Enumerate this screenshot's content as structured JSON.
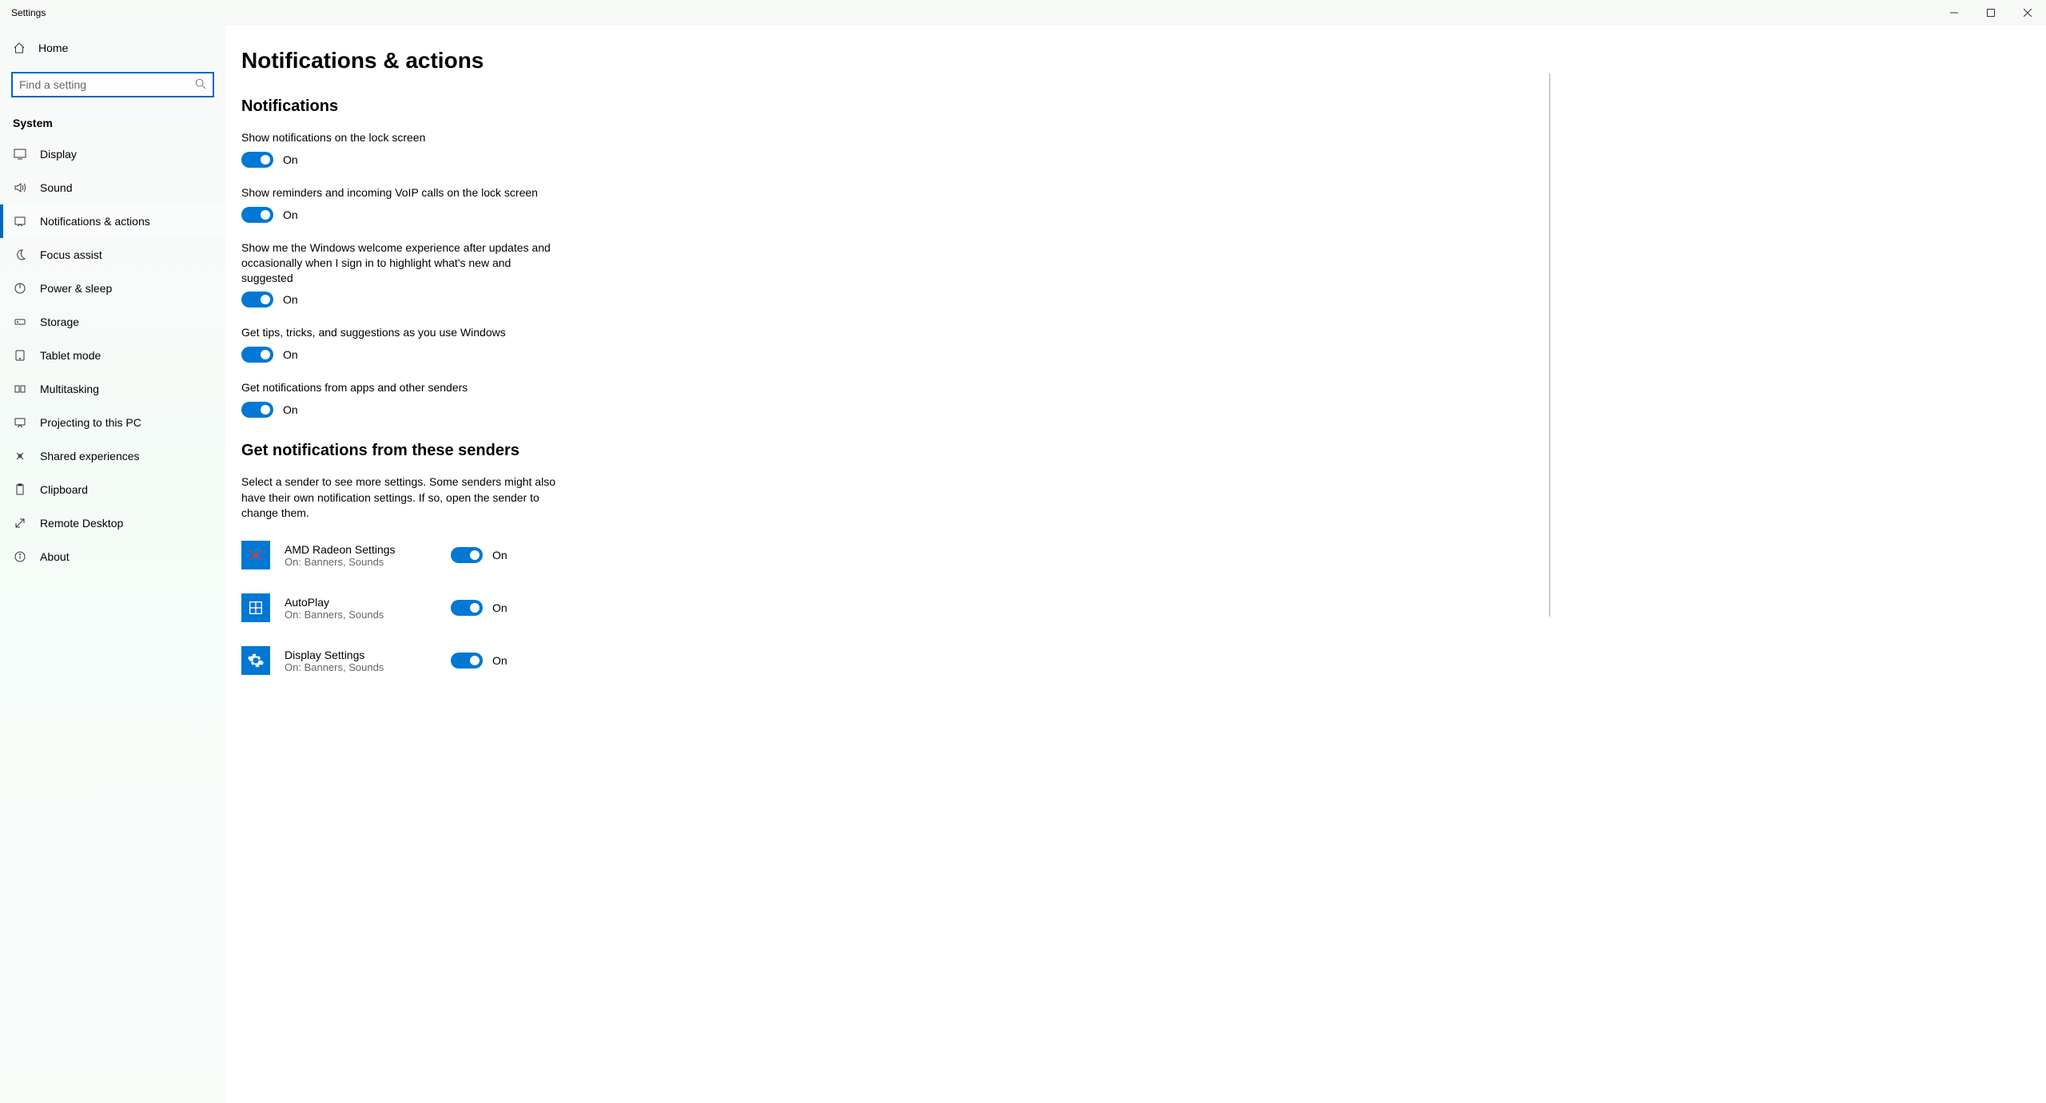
{
  "window": {
    "title": "Settings"
  },
  "sidebar": {
    "home_label": "Home",
    "search_placeholder": "Find a setting",
    "category_label": "System",
    "items": [
      {
        "label": "Display",
        "icon": "display"
      },
      {
        "label": "Sound",
        "icon": "sound"
      },
      {
        "label": "Notifications & actions",
        "icon": "notifications",
        "active": true
      },
      {
        "label": "Focus assist",
        "icon": "moon"
      },
      {
        "label": "Power & sleep",
        "icon": "power"
      },
      {
        "label": "Storage",
        "icon": "storage"
      },
      {
        "label": "Tablet mode",
        "icon": "tablet"
      },
      {
        "label": "Multitasking",
        "icon": "multitask"
      },
      {
        "label": "Projecting to this PC",
        "icon": "project"
      },
      {
        "label": "Shared experiences",
        "icon": "share"
      },
      {
        "label": "Clipboard",
        "icon": "clipboard"
      },
      {
        "label": "Remote Desktop",
        "icon": "remote"
      },
      {
        "label": "About",
        "icon": "info"
      }
    ]
  },
  "main": {
    "page_title": "Notifications & actions",
    "section_notifications": "Notifications",
    "toggles": [
      {
        "label": "Show notifications on the lock screen",
        "state": "On"
      },
      {
        "label": "Show reminders and incoming VoIP calls on the lock screen",
        "state": "On"
      },
      {
        "label": "Show me the Windows welcome experience after updates and occasionally when I sign in to highlight what's new and suggested",
        "state": "On"
      },
      {
        "label": "Get tips, tricks, and suggestions as you use Windows",
        "state": "On"
      },
      {
        "label": "Get notifications from apps and other senders",
        "state": "On"
      }
    ],
    "section_senders": "Get notifications from these senders",
    "senders_desc": "Select a sender to see more settings. Some senders might also have their own notification settings. If so, open the sender to change them.",
    "senders": [
      {
        "name": "AMD Radeon Settings",
        "sub": "On: Banners, Sounds",
        "state": "On",
        "color": "#c02020",
        "icon": "amd"
      },
      {
        "name": "AutoPlay",
        "sub": "On: Banners, Sounds",
        "state": "On",
        "color": "#0078d4",
        "icon": "autoplay"
      },
      {
        "name": "Display Settings",
        "sub": "On: Banners, Sounds",
        "state": "On",
        "color": "#0078d4",
        "icon": "gear"
      }
    ]
  }
}
